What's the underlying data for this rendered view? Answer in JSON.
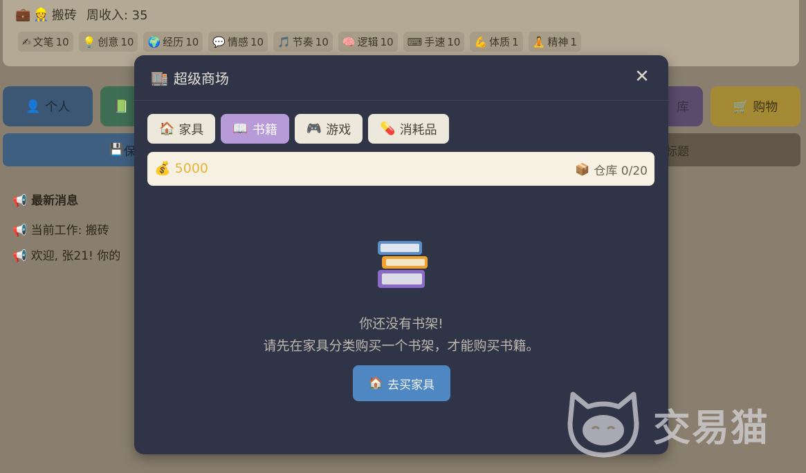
{
  "status": {
    "job_label": "搬砖",
    "weekly_income": "周收入: 35",
    "stats": [
      {
        "icon": "✍",
        "label": "文笔",
        "value": "10"
      },
      {
        "icon": "💡",
        "label": "创意",
        "value": "10"
      },
      {
        "icon": "🌍",
        "label": "经历",
        "value": "10"
      },
      {
        "icon": "💬",
        "label": "情感",
        "value": "10"
      },
      {
        "icon": "🎵",
        "label": "节奏",
        "value": "10"
      },
      {
        "icon": "🧠",
        "label": "逻辑",
        "value": "10"
      },
      {
        "icon": "⌨",
        "label": "手速",
        "value": "10"
      },
      {
        "icon": "💪",
        "label": "体质",
        "value": "1"
      },
      {
        "icon": "🧘",
        "label": "精神",
        "value": "1"
      }
    ]
  },
  "nav": {
    "personal_label": "个人",
    "purple_label": "库",
    "shop_label": "购物",
    "save_label": "保",
    "title_label": "标题"
  },
  "news": {
    "title": "最新消息",
    "lines": [
      "当前工作: 搬砖",
      "欢迎, 张21! 你的"
    ]
  },
  "modal": {
    "title": "超级商场",
    "close_symbol": "✕",
    "tabs": [
      {
        "icon": "🏠",
        "label": "家具",
        "active": false
      },
      {
        "icon": "📖",
        "label": "书籍",
        "active": true
      },
      {
        "icon": "🎮",
        "label": "游戏",
        "active": false
      },
      {
        "icon": "💊",
        "label": "消耗品",
        "active": false
      }
    ],
    "money": "5000",
    "storage": "仓库 0/20",
    "empty_title": "你还没有书架!",
    "empty_desc": "请先在家具分类购买一个书架，才能购买书籍。",
    "go_button_label": "去买家具"
  },
  "watermark": {
    "text": "交易猫"
  },
  "colors": {
    "modal_bg": "#2f3447",
    "active_tab": "#b69bd8",
    "tab_bg": "#ece8dc",
    "money": "#e6b43a",
    "go_button": "#4f87c2"
  }
}
